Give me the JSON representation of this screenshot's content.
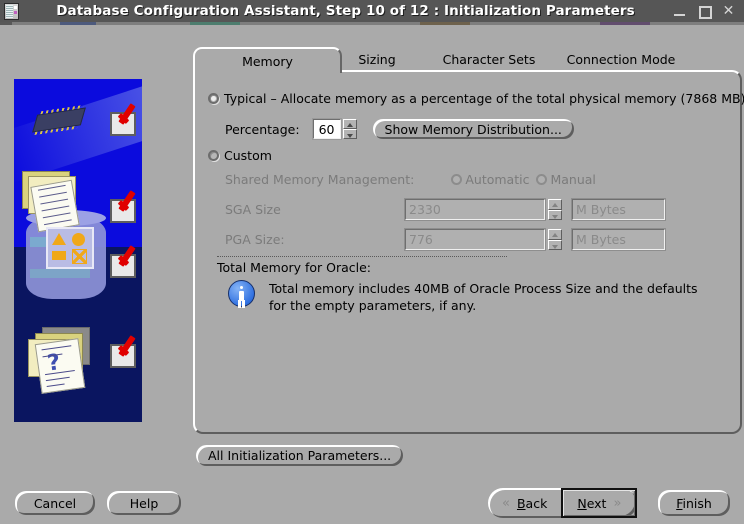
{
  "window": {
    "title": "Database Configuration Assistant, Step 10 of 12 : Initialization Parameters",
    "icon": "app-icon",
    "controls": {
      "minimize": "_",
      "maximize": "□",
      "close": "✕"
    }
  },
  "tabs": [
    {
      "label": "Memory",
      "selected": true
    },
    {
      "label": "Sizing",
      "selected": false
    },
    {
      "label": "Character Sets",
      "selected": false
    },
    {
      "label": "Connection Mode",
      "selected": false
    }
  ],
  "memory": {
    "typical": {
      "label": "Typical – Allocate memory as a percentage of the total physical memory (7868 MB)",
      "selected": true,
      "percentage_label": "Percentage:",
      "percentage_value": "60",
      "show_distribution_button": "Show Memory Distribution..."
    },
    "custom": {
      "label": "Custom",
      "selected": false,
      "smm_label": "Shared Memory Management:",
      "smm_options": [
        {
          "label": "Automatic",
          "selected": false
        },
        {
          "label": "Manual",
          "selected": false
        }
      ],
      "sga": {
        "label": "SGA Size",
        "value": "2330",
        "unit": "M Bytes"
      },
      "pga": {
        "label": "PGA Size:",
        "value": "776",
        "unit": "M Bytes"
      }
    },
    "total": {
      "label": "Total Memory for Oracle:",
      "icon": "info-icon",
      "text": "Total memory includes 40MB of Oracle Process Size and the defaults for the empty parameters, if any."
    }
  },
  "actions": {
    "all_params": "All Initialization Parameters...",
    "cancel": "Cancel",
    "help": "Help",
    "back": "Back",
    "back_mnemonic": "B",
    "next": "Next",
    "next_mnemonic": "N",
    "finish": "Finish",
    "finish_mnemonic": "F",
    "back_chevron": "«",
    "next_chevron": "»"
  },
  "colors": {
    "titlebar": "#565656",
    "window_bg": "#aaaaaa",
    "art_bg": "#0b0bdd",
    "art_bg_lower": "#0a1560",
    "check_red": "#e00000",
    "info_blue": "#2e6fe0",
    "disabled_text": "#7b7b7b"
  }
}
